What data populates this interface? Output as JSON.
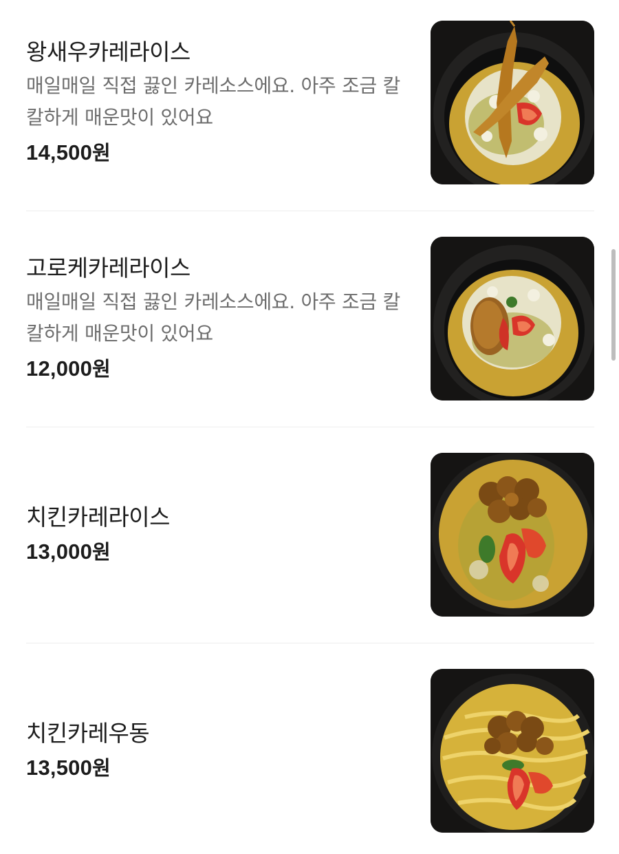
{
  "menu": {
    "items": [
      {
        "name": "왕새우카레라이스",
        "description": "매일매일 직접 끓인 카레소스에요. 아주 조금 칼칼하게 매운맛이 있어요",
        "price": "14,500",
        "currency": "원",
        "image": "curry-rice-with-fried-king-prawns"
      },
      {
        "name": "고로케카레라이스",
        "description": "매일매일 직접 끓인 카레소스에요. 아주 조금 칼칼하게 매운맛이 있어요",
        "price": "12,000",
        "currency": "원",
        "image": "curry-rice-with-croquette"
      },
      {
        "name": "치킨카레라이스",
        "price": "13,000",
        "currency": "원",
        "image": "curry-rice-with-fried-chicken"
      },
      {
        "name": "치킨카레우동",
        "price": "13,500",
        "currency": "원",
        "image": "curry-udon-with-fried-chicken"
      }
    ]
  },
  "colors": {
    "text_primary": "#1c1c1c",
    "text_secondary": "#6d6d6d",
    "divider": "#ededed",
    "curry": "#c9a233",
    "bowl": "#171615",
    "tomato": "#d9352a",
    "fried": "#b6781f",
    "scrollbar": "#bdbdbd"
  }
}
